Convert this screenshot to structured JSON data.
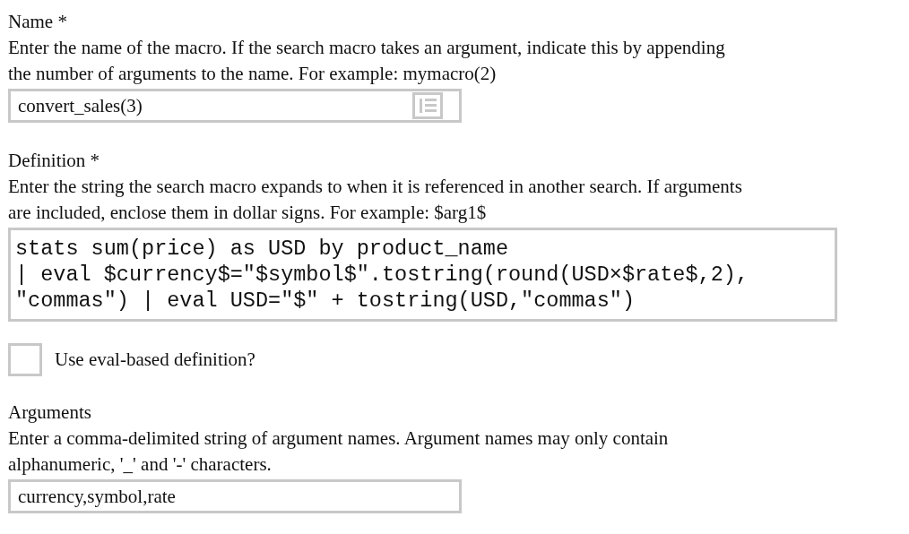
{
  "fields": [
    {
      "kind": "text",
      "title": "Name *",
      "help": [
        "Enter the name of the macro. If the search macro takes an argument, indicate this by appending",
        "the number of arguments to the name. For example: mymacro(2)"
      ],
      "value": "convert_sales(3)",
      "has_icon": true
    },
    {
      "kind": "code",
      "title": "Definition *",
      "help": [
        "Enter the string the search macro expands to when it is referenced in another search. If arguments",
        "are included, enclose them in dollar signs. For example: $arg1$"
      ],
      "lines": [
        "stats sum(price) as USD by product_name",
        "| eval $currency$=\"$symbol$\".tostring(round(USD×$rate$,2),",
        "\"commas\") | eval USD=\"$\" + tostring(USD,\"commas\")"
      ]
    },
    {
      "kind": "checkbox",
      "label": "Use eval-based definition?",
      "checked": false
    },
    {
      "kind": "text",
      "title": "Arguments",
      "help": [
        "Enter a comma-delimited string of argument names. Argument names may only contain",
        "alphanumeric, '_' and '-' characters."
      ],
      "value": "currency,symbol,rate",
      "has_icon": false
    }
  ]
}
